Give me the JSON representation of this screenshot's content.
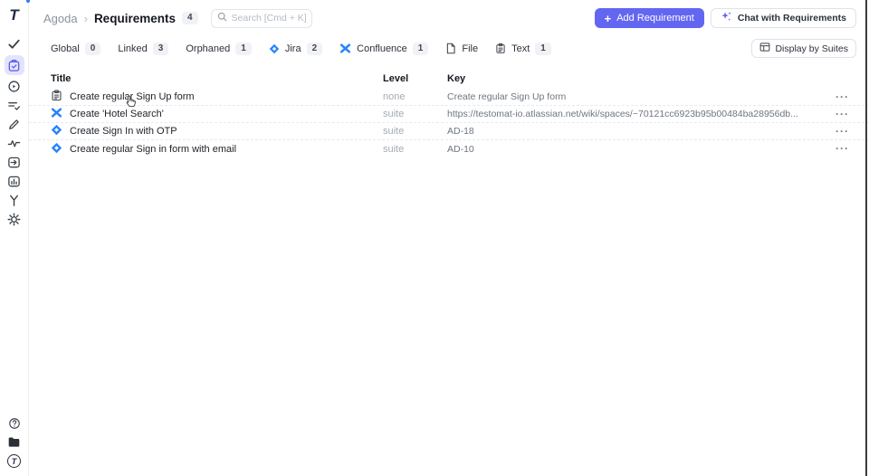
{
  "app": {
    "logo_letter": "T"
  },
  "colors": {
    "accent": "#6366f1",
    "jira_blue": "#2684ff",
    "active_item_bg": "#e3e4fb"
  },
  "sidebar": {
    "items": [
      {
        "name": "tests",
        "icon": "check-icon"
      },
      {
        "name": "requirements",
        "icon": "clipboard-check-icon",
        "active": true
      },
      {
        "name": "runs",
        "icon": "play-circle-icon"
      },
      {
        "name": "plans",
        "icon": "list-check-icon"
      },
      {
        "name": "editor",
        "icon": "pen-icon"
      },
      {
        "name": "pulse",
        "icon": "activity-icon"
      },
      {
        "name": "import",
        "icon": "import-box-icon"
      },
      {
        "name": "analytics",
        "icon": "bar-chart-box-icon"
      },
      {
        "name": "branches",
        "icon": "branch-icon"
      },
      {
        "name": "settings",
        "icon": "gear-icon"
      }
    ],
    "bottom_items": [
      {
        "name": "help",
        "icon": "help-circle-icon"
      },
      {
        "name": "projects",
        "icon": "folder-icon"
      },
      {
        "name": "account",
        "icon": "avatar-logo"
      }
    ]
  },
  "header": {
    "breadcrumb": {
      "project": "Agoda",
      "separator": "›",
      "page": "Requirements",
      "count": "4"
    },
    "search": {
      "placeholder": "Search [Cmd + K]"
    },
    "add_button": {
      "plus": "+",
      "label": "Add Requirement"
    },
    "chat_button": {
      "label": "Chat with Requirements"
    }
  },
  "filters": {
    "items": [
      {
        "label": "Global",
        "count": "0"
      },
      {
        "label": "Linked",
        "count": "3"
      },
      {
        "label": "Orphaned",
        "count": "1"
      },
      {
        "label": "Jira",
        "count": "2",
        "icon": "jira-icon"
      },
      {
        "label": "Confluence",
        "count": "1",
        "icon": "confluence-icon"
      },
      {
        "label": "File",
        "icon": "file-icon"
      },
      {
        "label": "Text",
        "count": "1",
        "icon": "text-clipboard-icon"
      }
    ],
    "display_button": {
      "label": "Display by Suites",
      "icon": "table-layout-icon"
    }
  },
  "table": {
    "columns": {
      "title": "Title",
      "level": "Level",
      "key": "Key"
    },
    "row_menu": "···",
    "rows": [
      {
        "icon": "text-clipboard-icon",
        "title": "Create regular Sign Up form",
        "level": "none",
        "key": "Create regular Sign Up form"
      },
      {
        "icon": "confluence-icon",
        "title": "Create 'Hotel Search'",
        "level": "suite",
        "key": "https://testomat-io.atlassian.net/wiki/spaces/~70121cc6923b95b00484ba28956db..."
      },
      {
        "icon": "jira-icon",
        "title": "Create Sign In with OTP",
        "level": "suite",
        "key": "AD-18"
      },
      {
        "icon": "jira-icon",
        "title": "Create regular Sign in form with email",
        "level": "suite",
        "key": "AD-10"
      }
    ]
  }
}
